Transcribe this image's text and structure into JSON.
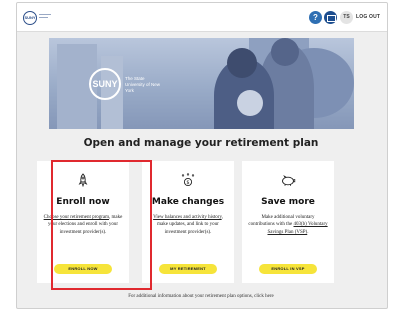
{
  "header": {
    "logo_text": "SUNY",
    "user_initials": "TS",
    "logout_label": "LOG OUT",
    "icons": [
      "help-icon",
      "mail-icon",
      "user-icon"
    ]
  },
  "hero": {
    "logo_text": "SUNY",
    "logo_caption": "The State University of New York"
  },
  "page_title": "Open and manage your retirement plan",
  "cards": [
    {
      "icon": "rocket-icon",
      "title": "Enroll now",
      "text_link": "Choose your retirement program",
      "text_rest": ", make your elections and enroll with your investment provider(s).",
      "button": "ENROLL NOW",
      "highlighted": true
    },
    {
      "icon": "dollar-growth-icon",
      "title": "Make changes",
      "text_link": "View balances and activity history",
      "text_rest": ", make updates, and link to your investment provider(s).",
      "button": "MY RETIREMENT",
      "highlighted": false
    },
    {
      "icon": "piggy-bank-icon",
      "title": "Save more",
      "text_pre": "Make additional voluntary contributions with the ",
      "text_link": "403(b) Voluntary Savings Plan (VSP)",
      "text_post": ".",
      "button": "ENROLL IN VSP",
      "highlighted": false
    }
  ],
  "footer_note": "For additional information about your retirement plan options, click here",
  "colors": {
    "button_yellow": "#f6e43a",
    "highlight_red": "#e0292f",
    "brand_blue": "#1d4e8f"
  }
}
